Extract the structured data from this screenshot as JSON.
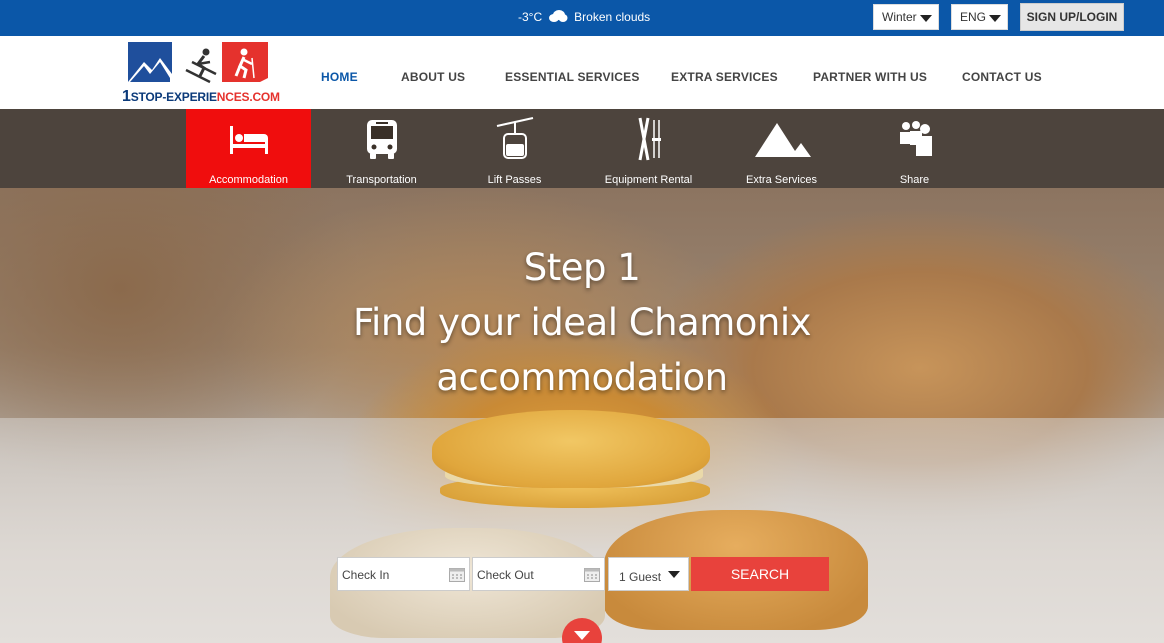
{
  "topbar": {
    "temperature": "-3°C",
    "weather": "Broken clouds",
    "weather_icon": "cloud-icon",
    "season": "Winter",
    "language": "ENG",
    "signup_label": "SIGN UP/LOGIN"
  },
  "logo": {
    "number": "1",
    "text_main": "STOP-EXPERIE",
    "text_accent": "NCES.COM"
  },
  "nav": {
    "items": [
      {
        "label": "HOME",
        "active": true
      },
      {
        "label": "ABOUT US"
      },
      {
        "label": "ESSENTIAL SERVICES"
      },
      {
        "label": "EXTRA SERVICES"
      },
      {
        "label": "PARTNER WITH US"
      },
      {
        "label": "CONTACT US"
      }
    ]
  },
  "services": [
    {
      "label": "Accommodation",
      "icon": "bed-icon",
      "active": true
    },
    {
      "label": "Transportation",
      "icon": "bus-icon"
    },
    {
      "label": "Lift Passes",
      "icon": "cable-car-icon"
    },
    {
      "label": "Equipment Rental",
      "icon": "skis-icon"
    },
    {
      "label": "Extra Services",
      "icon": "mountain-icon"
    },
    {
      "label": "Share",
      "icon": "people-icon"
    }
  ],
  "hero": {
    "line1": "Step 1",
    "line2": "Find your ideal Chamonix",
    "line3": "accommodation"
  },
  "search": {
    "check_in_placeholder": "Check In",
    "check_out_placeholder": "Check Out",
    "guests": "1 Guest",
    "button_label": "SEARCH"
  },
  "colors": {
    "brand_blue": "#0b57a8",
    "accent_red": "#e8423c",
    "active_service": "#f00d0d"
  }
}
